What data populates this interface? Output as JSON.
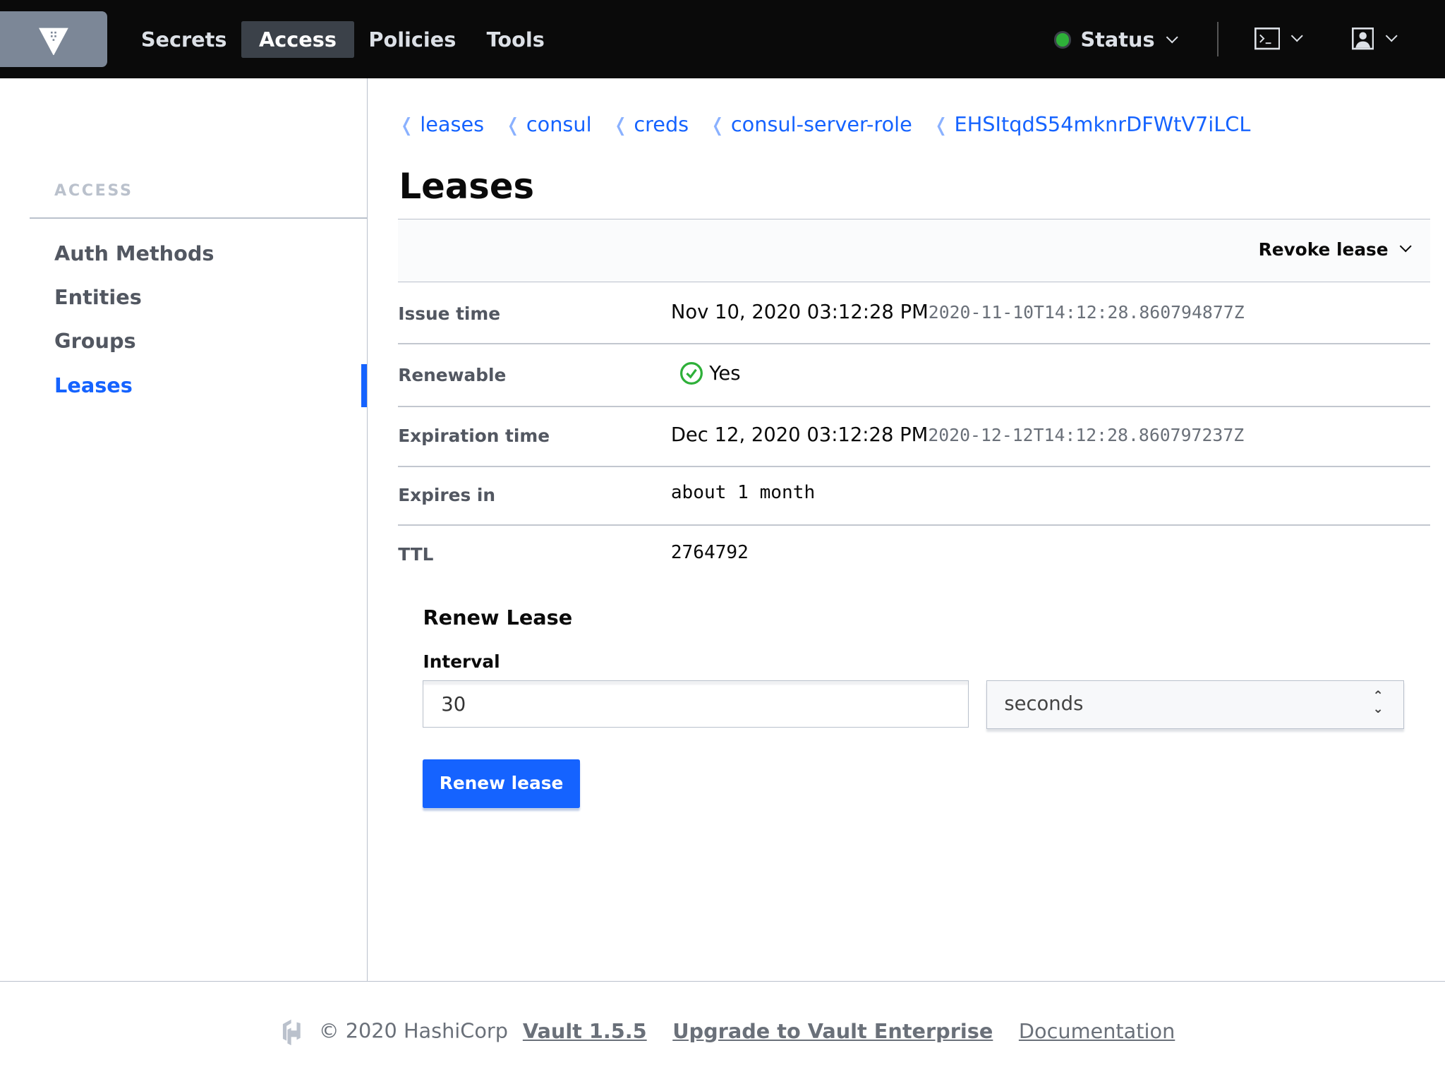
{
  "nav": {
    "items": [
      {
        "label": "Secrets"
      },
      {
        "label": "Access"
      },
      {
        "label": "Policies"
      },
      {
        "label": "Tools"
      }
    ],
    "status": "Status"
  },
  "sidebar": {
    "heading": "ACCESS",
    "items": [
      {
        "label": "Auth Methods"
      },
      {
        "label": "Entities"
      },
      {
        "label": "Groups"
      },
      {
        "label": "Leases"
      }
    ]
  },
  "breadcrumbs": [
    "leases",
    "consul",
    "creds",
    "consul-server-role",
    "EHSItqdS54mknrDFWtV7iLCL"
  ],
  "page": {
    "title": "Leases",
    "revoke_label": "Revoke lease"
  },
  "details": [
    {
      "label": "Issue time",
      "value": "Nov 10, 2020 03:12:28 PM",
      "iso": "2020-11-10T14:12:28.860794877Z"
    },
    {
      "label": "Renewable",
      "value": "Yes"
    },
    {
      "label": "Expiration time",
      "value": "Dec 12, 2020 03:12:28 PM",
      "iso": "2020-12-12T14:12:28.860797237Z"
    },
    {
      "label": "Expires in",
      "value": "about 1 month"
    },
    {
      "label": "TTL",
      "value": "2764792"
    }
  ],
  "renew": {
    "heading": "Renew Lease",
    "interval_label": "Interval",
    "interval_value": "30",
    "unit": "seconds",
    "button": "Renew lease"
  },
  "footer": {
    "copyright": "© 2020 HashiCorp",
    "version": "Vault 1.5.5",
    "upgrade": "Upgrade to Vault Enterprise",
    "docs": "Documentation"
  },
  "colors": {
    "accent": "#1563ff",
    "status_ok": "#2eb039",
    "nav_bg": "#0a0a0a"
  }
}
